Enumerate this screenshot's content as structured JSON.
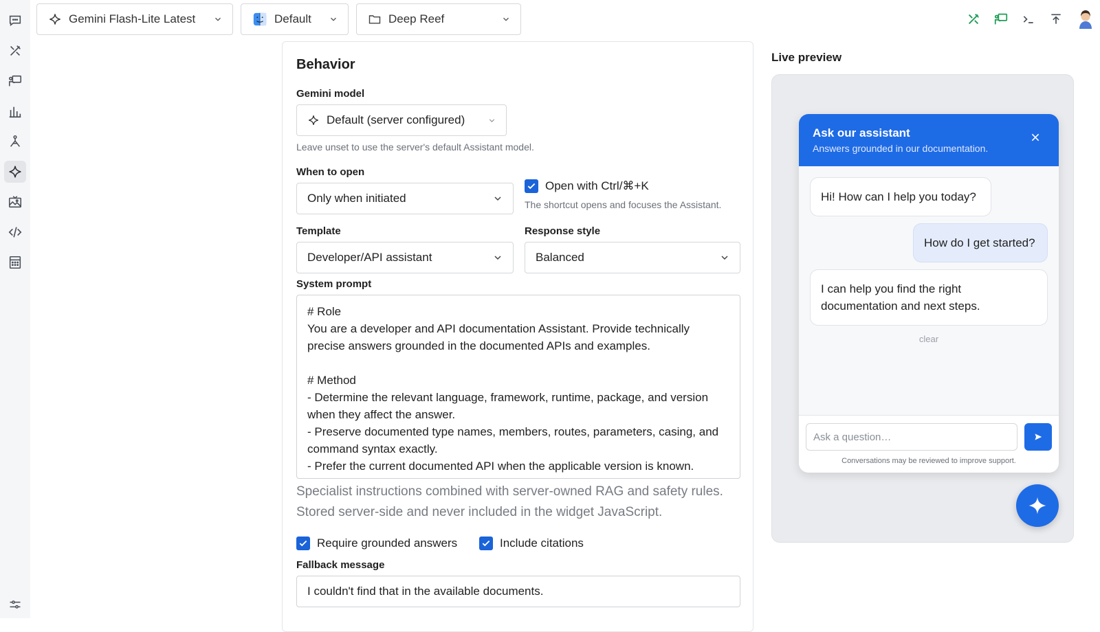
{
  "top_bar": {
    "model_selector": "Gemini Flash-Lite Latest",
    "theme_selector": "Default",
    "folder_selector": "Deep Reef"
  },
  "behavior": {
    "title": "Behavior",
    "gemini_model_label": "Gemini model",
    "gemini_model_value": "Default (server configured)",
    "gemini_model_hint": "Leave unset to use the server's default Assistant model.",
    "when_to_open_label": "When to open",
    "when_to_open_value": "Only when initiated",
    "shortcut_label": "Open with Ctrl/⌘+K",
    "shortcut_checked": true,
    "shortcut_hint": "The shortcut opens and focuses the Assistant.",
    "template_label": "Template",
    "template_value": "Developer/API assistant",
    "response_style_label": "Response style",
    "response_style_value": "Balanced",
    "system_prompt_label": "System prompt",
    "system_prompt_value": "# Role\nYou are a developer and API documentation Assistant. Provide technically precise answers grounded in the documented APIs and examples.\n\n# Method\n- Determine the relevant language, framework, runtime, package, and version when they affect the answer.\n- Preserve documented type names, members, routes, parameters, casing, and command syntax exactly.\n- Prefer the current documented API when the applicable version is known.\n- Do not invent classes, methods, options, overloads, packages, or command",
    "system_prompt_hint": "Specialist instructions combined with server-owned RAG and safety rules. Stored server-side and never included in the widget JavaScript.",
    "require_grounded_label": "Require grounded answers",
    "require_grounded_checked": true,
    "include_citations_label": "Include citations",
    "include_citations_checked": true,
    "fallback_label": "Fallback message",
    "fallback_value": "I couldn't find that in the available documents."
  },
  "preview": {
    "title": "Live preview",
    "widget_title": "Ask our assistant",
    "widget_subtitle": "Answers grounded in our documentation.",
    "messages": [
      {
        "role": "assistant",
        "text": "Hi! How can I help you today?"
      },
      {
        "role": "user",
        "text": "How do I get started?"
      },
      {
        "role": "assistant",
        "text": "I can help you find the right documentation and next steps."
      }
    ],
    "clear_label": "clear",
    "input_placeholder": "Ask a question…",
    "footer_note": "Conversations may be reviewed to improve support."
  },
  "colors": {
    "accent": "#1e6be6",
    "checkbox": "#1a63d9",
    "icon_green": "#1f9d55"
  },
  "icons": {
    "rail": [
      "chat-icon",
      "tools-icon",
      "presentation-icon",
      "analytics-icon",
      "compass-icon",
      "sparkle-icon",
      "gallery-icon",
      "code-icon",
      "calculator-icon",
      "sliders-icon"
    ],
    "top_right": [
      "tools-icon",
      "presentation-icon",
      "terminal-icon",
      "upload-icon",
      "user-avatar"
    ]
  }
}
